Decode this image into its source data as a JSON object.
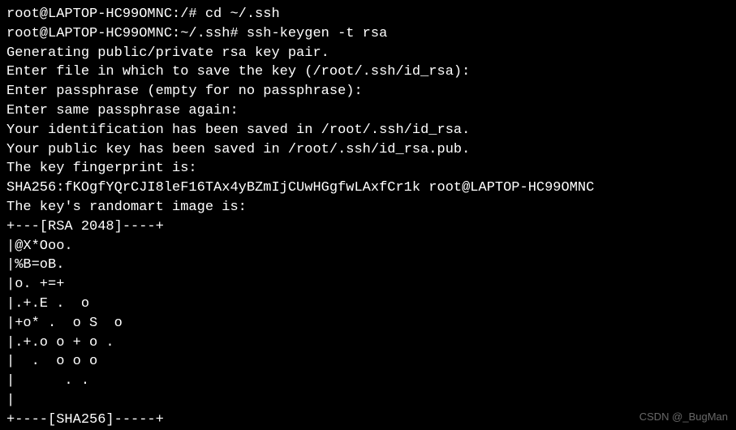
{
  "terminal": {
    "lines": [
      "root@LAPTOP-HC99OMNC:/# cd ~/.ssh",
      "root@LAPTOP-HC99OMNC:~/.ssh# ssh-keygen -t rsa",
      "Generating public/private rsa key pair.",
      "Enter file in which to save the key (/root/.ssh/id_rsa):",
      "Enter passphrase (empty for no passphrase):",
      "Enter same passphrase again:",
      "Your identification has been saved in /root/.ssh/id_rsa.",
      "Your public key has been saved in /root/.ssh/id_rsa.pub.",
      "The key fingerprint is:",
      "SHA256:fKOgfYQrCJI8leF16TAx4yBZmIjCUwHGgfwLAxfCr1k root@LAPTOP-HC99OMNC",
      "The key's randomart image is:",
      "+---[RSA 2048]----+",
      "|@X*Ooo.",
      "|%B=oB.",
      "|o. +=+",
      "|.+.E .  o",
      "|+o* .  o S  o",
      "|.+.o o + o .",
      "|  .  o o o",
      "|      . .",
      "|",
      "+----[SHA256]-----+"
    ]
  },
  "watermark": {
    "text": "CSDN @_BugMan"
  }
}
